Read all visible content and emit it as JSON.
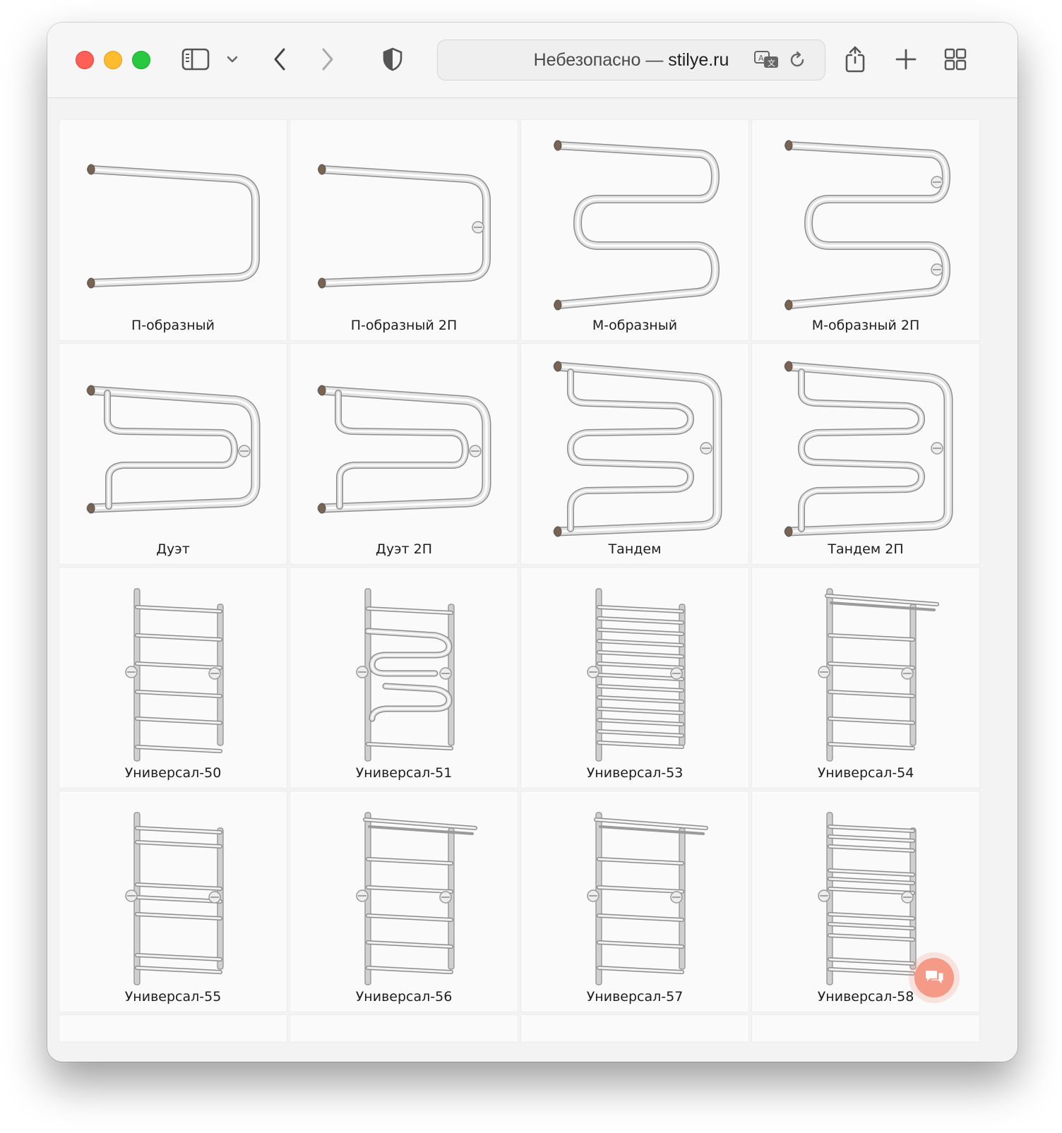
{
  "browser": {
    "address": {
      "prefix": "Небезопасно —",
      "host": "stilye.ru"
    },
    "icons": [
      "sidebar-icon",
      "chevron-down-icon",
      "back-icon",
      "forward-icon",
      "shield-icon",
      "translate-icon",
      "reload-icon",
      "share-icon",
      "plus-icon",
      "tabs-grid-icon"
    ]
  },
  "products": [
    {
      "name": "П-образный",
      "shape": "p"
    },
    {
      "name": "П-образный 2П",
      "shape": "p2"
    },
    {
      "name": "М-образный",
      "shape": "m"
    },
    {
      "name": "М-образный 2П",
      "shape": "m2"
    },
    {
      "name": "Дуэт",
      "shape": "duet"
    },
    {
      "name": "Дуэт 2П",
      "shape": "duet2"
    },
    {
      "name": "Тандем",
      "shape": "tandem"
    },
    {
      "name": "Тандем 2П",
      "shape": "tandem2"
    },
    {
      "name": "Универсал-50",
      "shape": "ladder6"
    },
    {
      "name": "Универсал-51",
      "shape": "ladderS"
    },
    {
      "name": "Универсал-53",
      "shape": "ladderDense"
    },
    {
      "name": "Универсал-54",
      "shape": "ladderShelf"
    },
    {
      "name": "Универсал-55",
      "shape": "ladderGroups"
    },
    {
      "name": "Универсал-56",
      "shape": "ladderShelf2"
    },
    {
      "name": "Универсал-57",
      "shape": "ladderShelf2"
    },
    {
      "name": "Универсал-58",
      "shape": "ladderDense2"
    }
  ],
  "chat": {
    "icon": "chat-icon",
    "color": "#f49a87"
  }
}
